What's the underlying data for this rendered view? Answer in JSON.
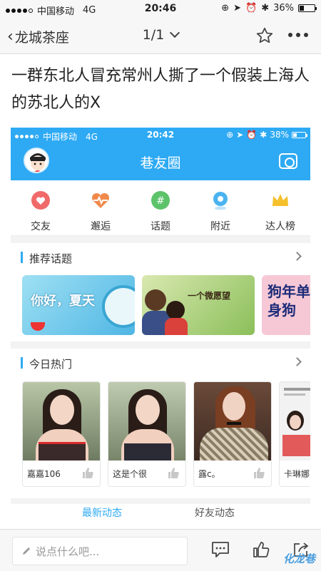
{
  "status_bar": {
    "carrier": "中国移动",
    "network": "4G",
    "time": "20:46",
    "battery": "36%",
    "battery_fraction": 0.36
  },
  "nav": {
    "back_label": "龙城茶座",
    "pager": "1/1"
  },
  "post": {
    "title": "一群东北人冒充常州人撕了一个假装上海人的苏北人的X"
  },
  "embedded": {
    "status_bar": {
      "carrier": "中国移动",
      "network": "4G",
      "time": "20:42",
      "battery": "38%",
      "battery_fraction": 0.38
    },
    "header_title": "巷友圈",
    "quick_links": [
      {
        "label": "交友",
        "icon": "heart-icon",
        "color": "#f06a6a"
      },
      {
        "label": "邂逅",
        "icon": "heartbeat-icon",
        "color": "#f08a4b"
      },
      {
        "label": "话题",
        "icon": "hashtag-icon",
        "color": "#5cc36a"
      },
      {
        "label": "附近",
        "icon": "location-icon",
        "color": "#4ab3f0"
      },
      {
        "label": "达人榜",
        "icon": "crown-icon",
        "color": "#f5c02b"
      }
    ],
    "recommended": {
      "title": "推荐话题",
      "topics": [
        {
          "text": "你好，夏天"
        },
        {
          "text": "一个微愿望"
        },
        {
          "text": "狗年单身狗"
        }
      ]
    },
    "hot": {
      "title": "今日热门",
      "cards": [
        {
          "name": "嘉嘉106"
        },
        {
          "name": "这是个很"
        },
        {
          "name": "露c。"
        },
        {
          "name": "卡琳娜"
        }
      ]
    },
    "tabs_peek": [
      "最新动态",
      "好友动态"
    ]
  },
  "bottom_bar": {
    "comment_placeholder": "说点什么吧...",
    "watermark": "化龙巷"
  },
  "colors": {
    "accent": "#2eaaf4"
  }
}
